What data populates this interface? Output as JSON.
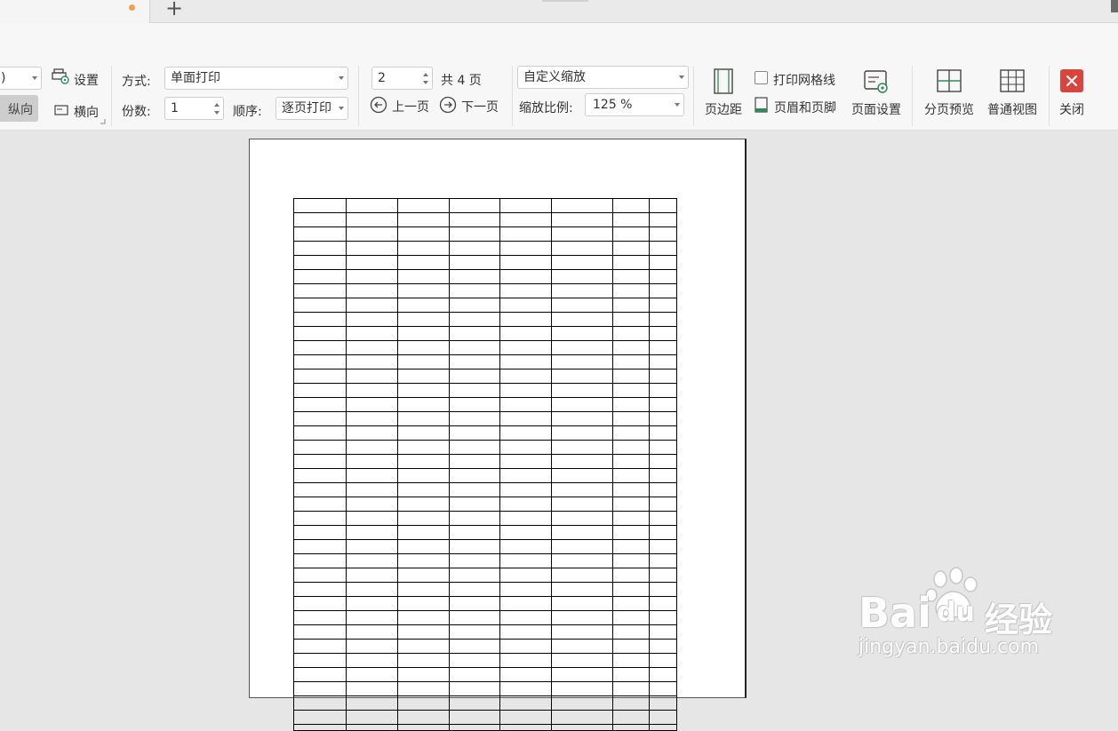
{
  "tabs": {
    "add_label": "+"
  },
  "ribbon": {
    "paper_size_value": ")",
    "portrait_label": "纵向",
    "landscape_label": "横向",
    "settings_label": "设置",
    "mode_label": "方式:",
    "mode_value": "单面打印",
    "copies_label": "份数:",
    "copies_value": "1",
    "order_label": "顺序:",
    "order_value": "逐页打印",
    "page_number_value": "2",
    "total_pages_label": "共 4 页",
    "prev_page_label": "上一页",
    "next_page_label": "下一页",
    "zoom_mode_value": "自定义缩放",
    "zoom_ratio_label": "缩放比例:",
    "zoom_ratio_value": "125 %",
    "margins_label": "页边距",
    "print_gridlines_label": "打印网格线",
    "print_gridlines_checked": false,
    "header_footer_label": "页眉和页脚",
    "page_setup_label": "页面设置",
    "page_break_preview_label": "分页预览",
    "normal_view_label": "普通视图",
    "close_label": "关闭"
  },
  "colors": {
    "accent_close": "#d9443c",
    "icon_green": "#2e8b57",
    "tab_dot": "#f0a050"
  },
  "watermark": {
    "brand": "Bai",
    "brand_paw": "du",
    "suffix": "经验",
    "url": "jingyan.baidu.com"
  }
}
